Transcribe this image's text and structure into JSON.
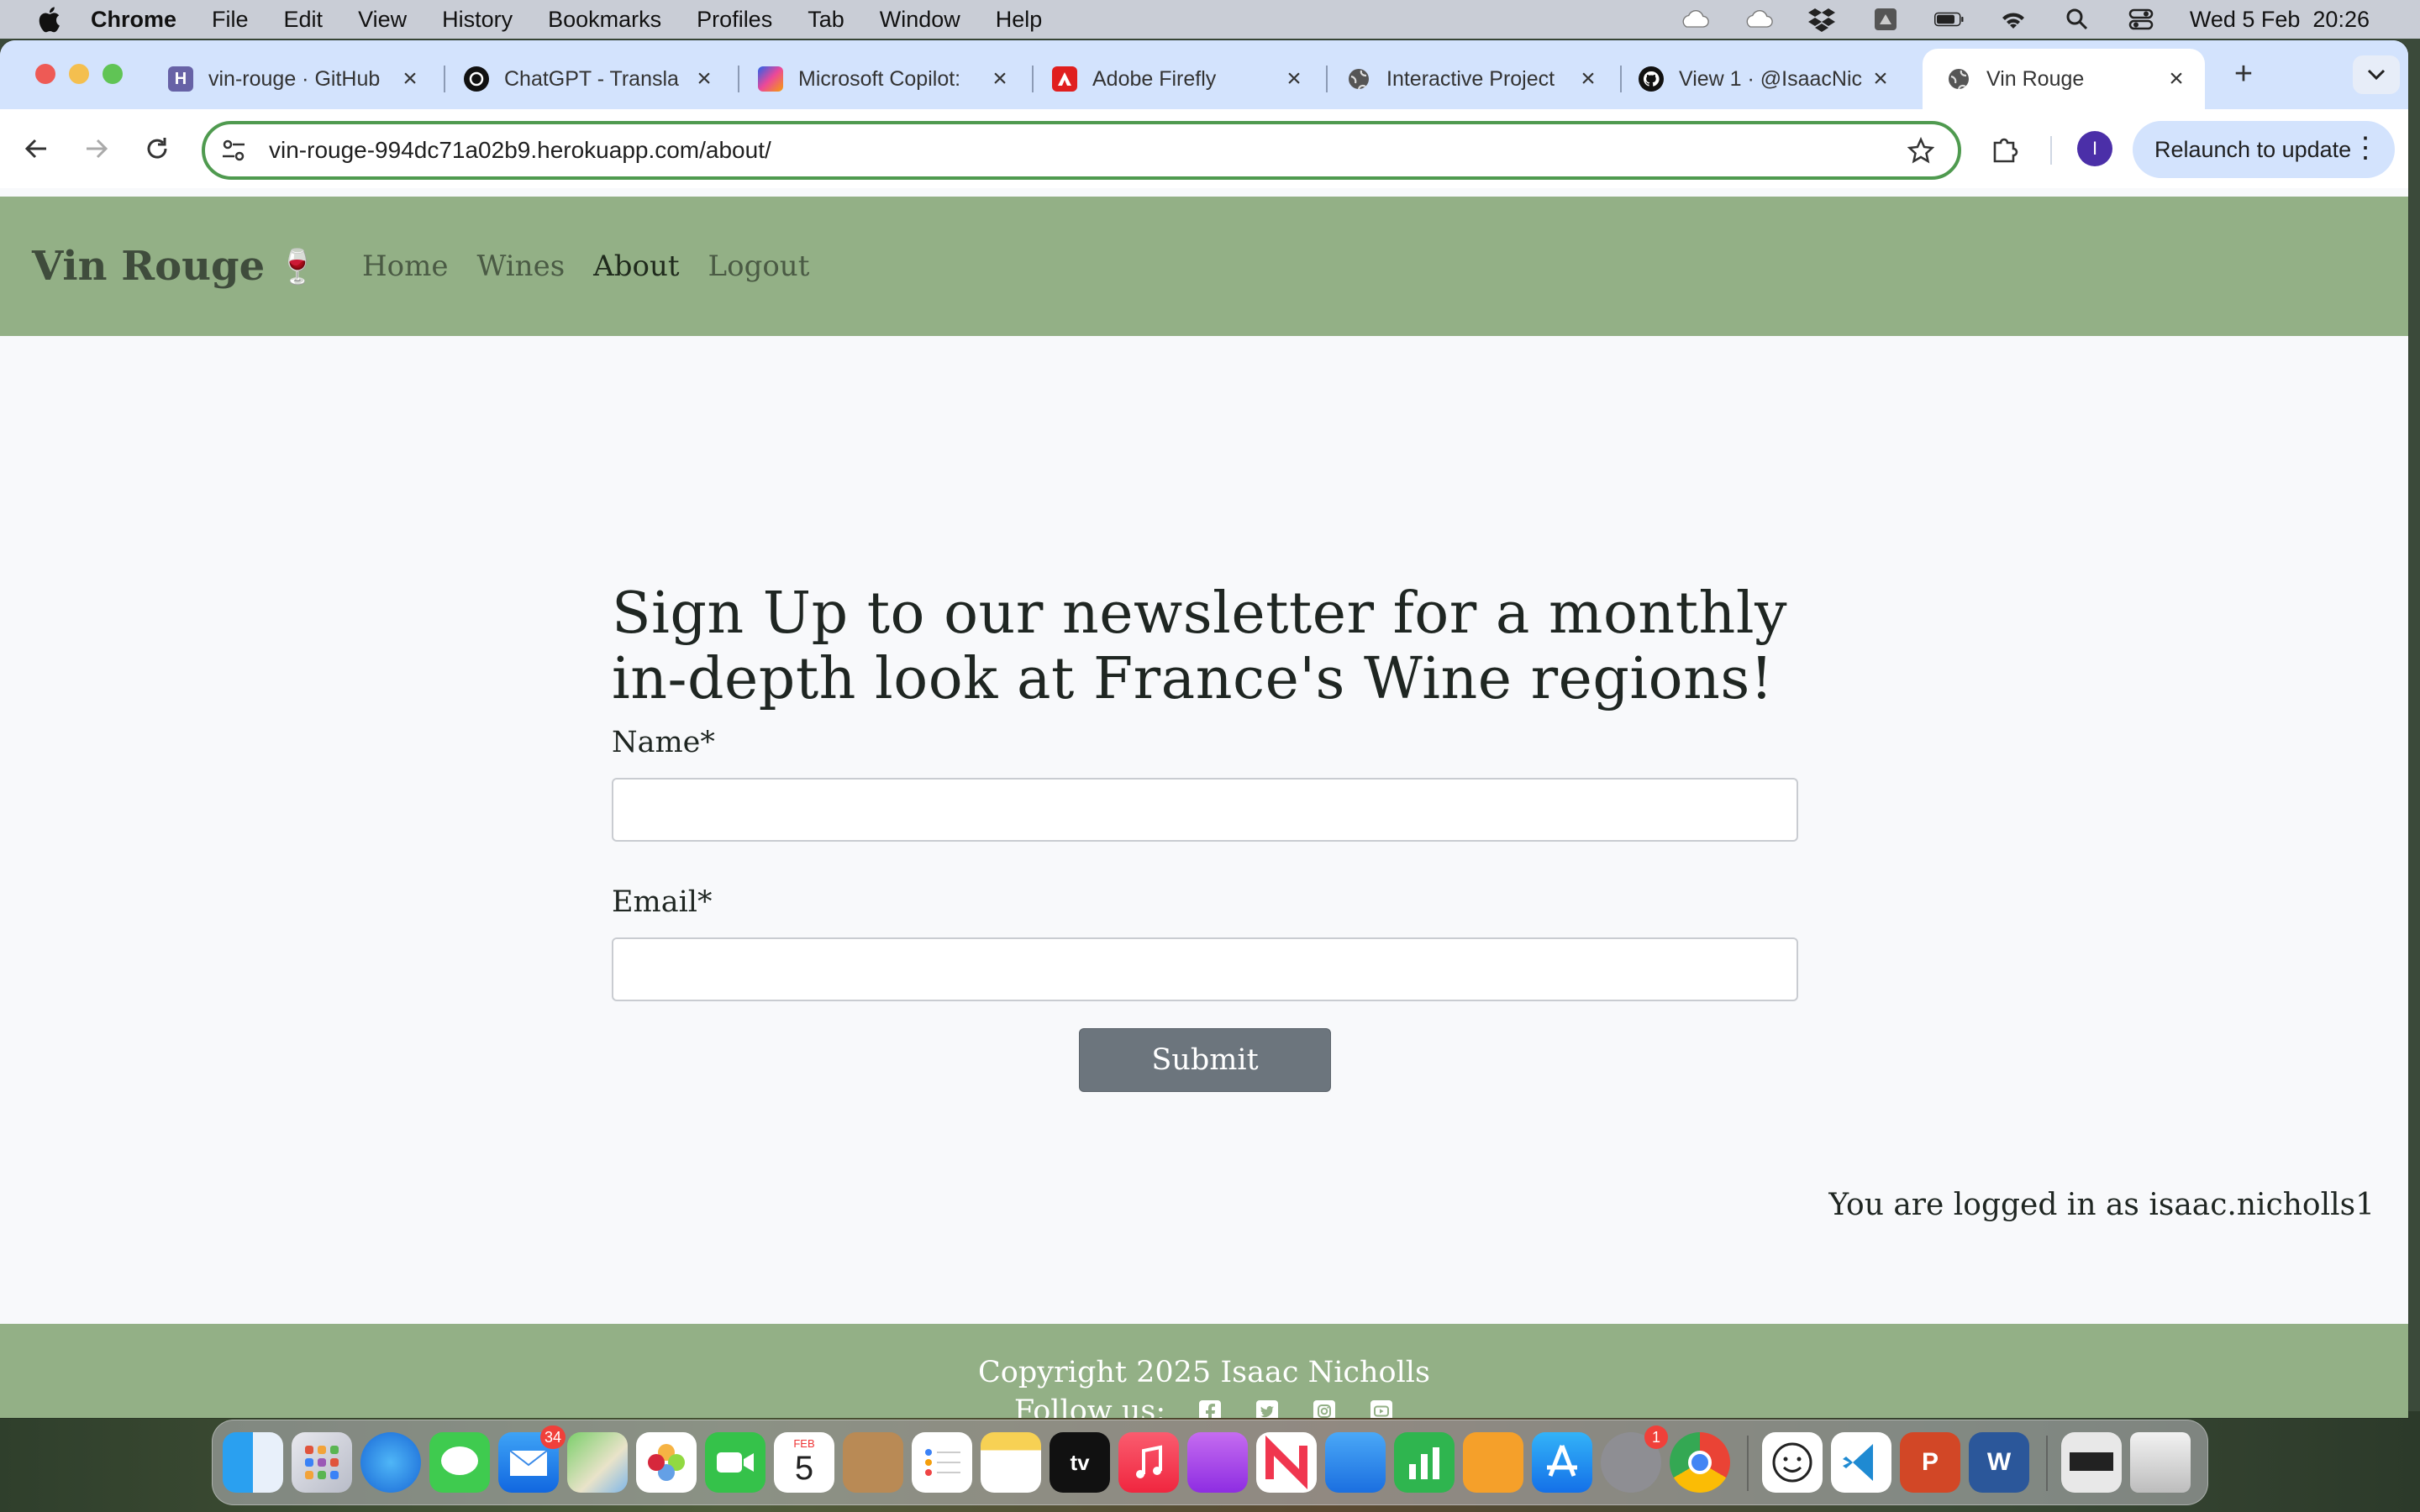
{
  "menubar": {
    "app_name": "Chrome",
    "items": [
      "File",
      "Edit",
      "View",
      "History",
      "Bookmarks",
      "Profiles",
      "Tab",
      "Window",
      "Help"
    ],
    "clock": "Wed 5 Feb  20:26"
  },
  "tabs": [
    {
      "title": "vin-rouge · GitHub",
      "icon": "heroku-icon",
      "color": "#6762a6"
    },
    {
      "title": "ChatGPT - Transla",
      "icon": "chatgpt-icon",
      "color": "#111111"
    },
    {
      "title": "Microsoft Copilot:",
      "icon": "copilot-icon",
      "color": "#3b82f6"
    },
    {
      "title": "Adobe Firefly",
      "icon": "adobe-icon",
      "color": "#e01e1e"
    },
    {
      "title": "Interactive Project",
      "icon": "globe-icon",
      "color": "#444444"
    },
    {
      "title": "View 1 · @IsaacNic",
      "icon": "github-icon",
      "color": "#111111"
    },
    {
      "title": "Vin Rouge",
      "icon": "globe-icon",
      "color": "#444444",
      "active": true
    }
  ],
  "toolbar": {
    "url": "vin-rouge-994dc71a02b9.herokuapp.com/about/",
    "profile_initial": "I",
    "relaunch_label": "Relaunch to update"
  },
  "site": {
    "brand": "Vin Rouge",
    "brand_emoji": "🍷",
    "nav": [
      "Home",
      "Wines",
      "About",
      "Logout"
    ],
    "active_nav": "About",
    "heading": "Sign Up to our newsletter for a monthly in-depth look at France's Wine regions!",
    "name_label": "Name*",
    "email_label": "Email*",
    "submit_label": "Submit",
    "logged_in_text": "You are logged in as isaac.nicholls1",
    "footer_copyright": "Copyright 2025 Isaac Nicholls",
    "footer_follow": "Follow us:",
    "social_icons": [
      "facebook-icon",
      "twitter-icon",
      "instagram-icon",
      "youtube-icon"
    ]
  },
  "colors": {
    "nav_green": "#93b086",
    "omnibox_border": "#4f9a4f",
    "submit_gray": "#6c757d"
  },
  "dock": {
    "mail_badge": "34",
    "calendar_month": "FEB",
    "calendar_day": "5",
    "settings_badge": "1",
    "apps": [
      "finder-icon",
      "launchpad-icon",
      "safari-icon",
      "messages-icon",
      "mail-icon",
      "maps-icon",
      "photos-icon",
      "facetime-icon",
      "calendar-icon",
      "contacts-icon",
      "reminders-icon",
      "notes-icon",
      "tv-icon",
      "music-icon",
      "podcasts-icon",
      "news-icon",
      "keynote-icon",
      "numbers-icon",
      "pages-icon",
      "appstore-icon",
      "settings-icon",
      "chrome-icon",
      "facetracker-icon",
      "vscode-icon",
      "powerpoint-icon",
      "word-icon",
      "preview-icon",
      "trash-icon"
    ]
  }
}
